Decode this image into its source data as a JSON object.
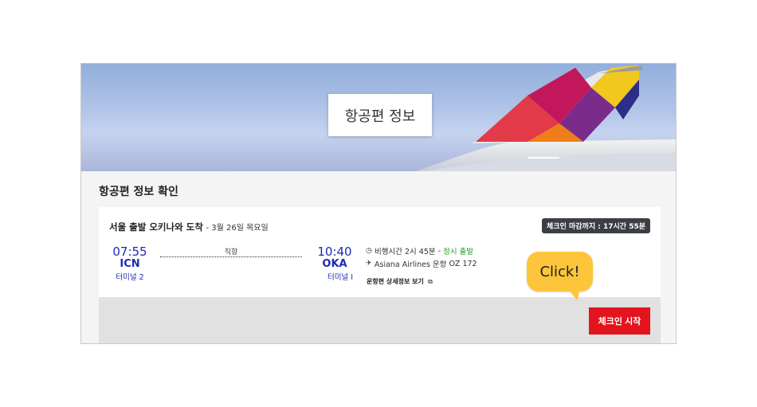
{
  "header": {
    "title": "항공편 정보"
  },
  "section": {
    "title": "항공편 정보 확인"
  },
  "flight": {
    "route": "서울 출발 오키나와 도착",
    "date": "- 3월 26일 목요일",
    "deadline": "체크인 마감까지 : 17시간 55분",
    "departure": {
      "time": "07:55",
      "code": "ICN",
      "terminal": "터미널 2"
    },
    "arrival": {
      "time": "10:40",
      "code": "OKA",
      "terminal": "터미널 I"
    },
    "direct_label": "직항",
    "duration": "비행시간 2시 45분",
    "status": "정시 출발",
    "airline": "Asiana Airlines 운항",
    "flight_number": "OZ 172",
    "detail_link": "운항편 상세정보 보기"
  },
  "actions": {
    "checkin_label": "체크인 시작"
  },
  "callout": {
    "text": "Click!"
  },
  "colors": {
    "accent": "#e3141d",
    "time_blue": "#1a2bb5",
    "callout": "#fcc53b",
    "status_green": "#2a9a2a"
  }
}
